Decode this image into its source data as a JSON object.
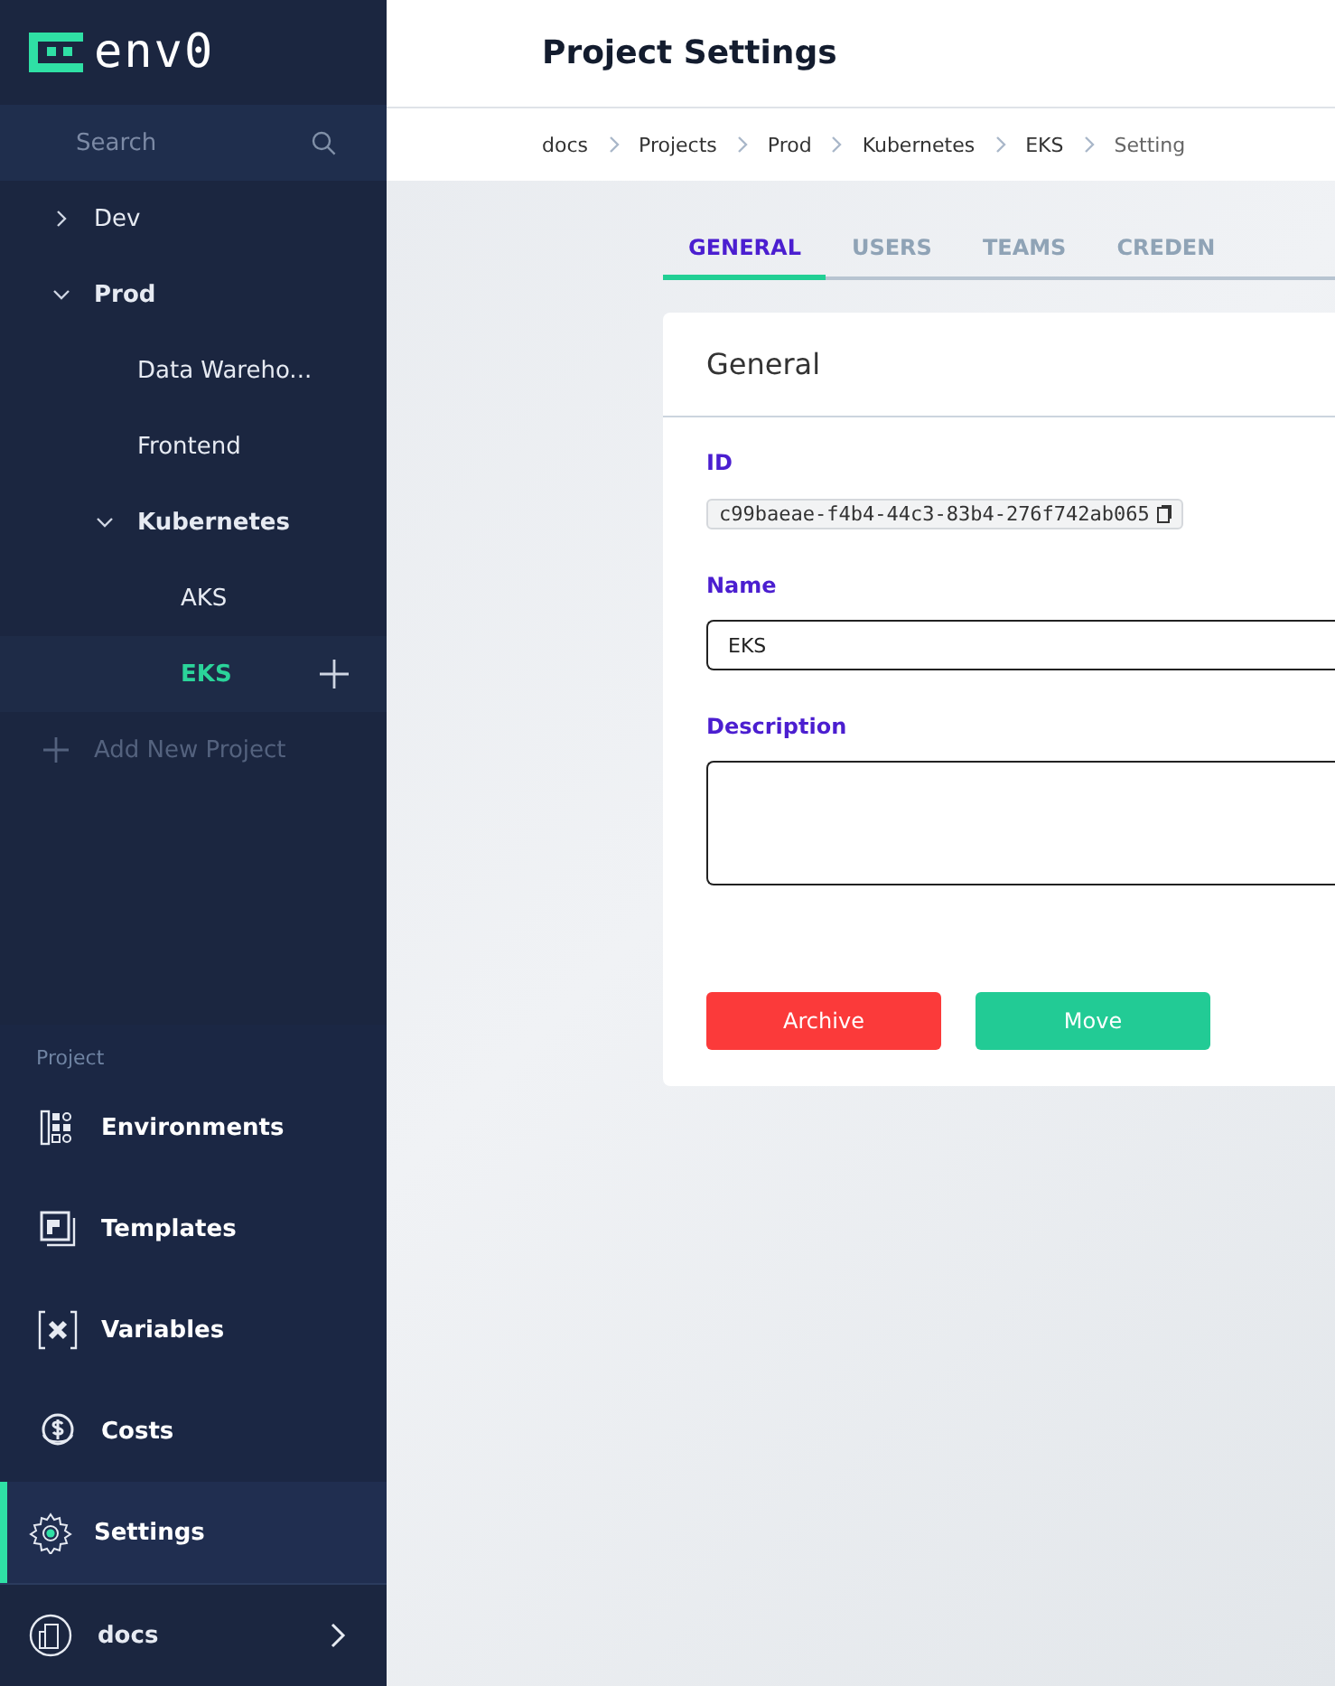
{
  "logo": {
    "text": "env0"
  },
  "search": {
    "placeholder": "Search"
  },
  "tree": [
    {
      "label": "Dev",
      "expanded": false,
      "selected": false
    },
    {
      "label": "Prod",
      "expanded": true,
      "selected": false,
      "children": [
        {
          "label": "Data Wareho...",
          "selected": false
        },
        {
          "label": "Frontend",
          "selected": false
        },
        {
          "label": "Kubernetes",
          "expanded": true,
          "selected": false,
          "children": [
            {
              "label": "AKS",
              "selected": false
            },
            {
              "label": "EKS",
              "selected": true
            }
          ]
        }
      ]
    }
  ],
  "add_project": {
    "label": "Add New Project"
  },
  "nav": {
    "section": "Project",
    "items": [
      {
        "label": "Environments",
        "kind": "environments",
        "selected": false
      },
      {
        "label": "Templates",
        "kind": "templates",
        "selected": false
      },
      {
        "label": "Variables",
        "kind": "variables",
        "selected": false
      },
      {
        "label": "Costs",
        "kind": "costs",
        "selected": false
      },
      {
        "label": "Settings",
        "kind": "settings",
        "selected": true
      }
    ]
  },
  "org": {
    "label": "docs"
  },
  "page_title": "Project Settings",
  "breadcrumb": [
    "docs",
    "Projects",
    "Prod",
    "Kubernetes",
    "EKS",
    "Setting"
  ],
  "tabs": [
    {
      "label": "GENERAL",
      "selected": true
    },
    {
      "label": "USERS",
      "selected": false
    },
    {
      "label": "TEAMS",
      "selected": false
    },
    {
      "label": "CREDEN",
      "selected": false
    }
  ],
  "card": {
    "title": "General",
    "id_label": "ID",
    "id_value": "c99baeae-f4b4-44c3-83b4-276f742ab065",
    "name_label": "Name",
    "name_value": "EKS",
    "description_label": "Description",
    "buttons": [
      {
        "label": "Archive",
        "kind": "danger"
      },
      {
        "label": "Move",
        "kind": "primary"
      }
    ]
  }
}
